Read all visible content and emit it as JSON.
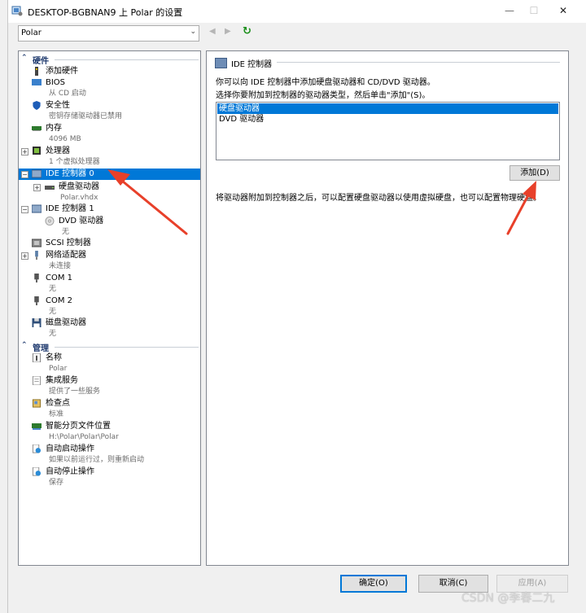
{
  "window": {
    "title": "DESKTOP-BGBNAN9 上 Polar 的设置",
    "minimize": "—",
    "maximize": "☐",
    "close": "✕"
  },
  "toolbar": {
    "vm_select": "Polar",
    "back": "◀",
    "forward": "▶",
    "refresh": "↻"
  },
  "tree": {
    "hardware_header": "硬件",
    "management_header": "管理",
    "items": [
      {
        "label": "添加硬件",
        "sub": ""
      },
      {
        "label": "BIOS",
        "sub": "从 CD 启动"
      },
      {
        "label": "安全性",
        "sub": "密钥存储驱动器已禁用"
      },
      {
        "label": "内存",
        "sub": "4096 MB"
      },
      {
        "label": "处理器",
        "sub": "1 个虚拟处理器"
      },
      {
        "label": "IDE 控制器 0",
        "sub": ""
      },
      {
        "label": "硬盘驱动器",
        "sub": "Polar.vhdx"
      },
      {
        "label": "IDE 控制器 1",
        "sub": ""
      },
      {
        "label": "DVD 驱动器",
        "sub": "无"
      },
      {
        "label": "SCSI 控制器",
        "sub": ""
      },
      {
        "label": "网络适配器",
        "sub": "未连接"
      },
      {
        "label": "COM 1",
        "sub": "无"
      },
      {
        "label": "COM 2",
        "sub": "无"
      },
      {
        "label": "磁盘驱动器",
        "sub": "无"
      },
      {
        "label": "名称",
        "sub": "Polar"
      },
      {
        "label": "集成服务",
        "sub": "提供了一些服务"
      },
      {
        "label": "检查点",
        "sub": "标准"
      },
      {
        "label": "智能分页文件位置",
        "sub": "H:\\Polar\\Polar\\Polar"
      },
      {
        "label": "自动启动操作",
        "sub": "如果以前运行过，则重新启动"
      },
      {
        "label": "自动停止操作",
        "sub": "保存"
      }
    ]
  },
  "panel": {
    "header": "IDE 控制器",
    "desc1": "你可以向 IDE 控制器中添加硬盘驱动器和 CD/DVD 驱动器。",
    "desc2": "选择你要附加到控制器的驱动器类型，然后单击\"添加\"(S)。",
    "options": [
      "硬盘驱动器",
      "DVD 驱动器"
    ],
    "selected_option": "硬盘驱动器",
    "add_button": "添加(D)",
    "note": "将驱动器附加到控制器之后，可以配置硬盘驱动器以使用虚拟硬盘，也可以配置物理硬盘。"
  },
  "footer": {
    "ok": "确定(O)",
    "cancel": "取消(C)",
    "apply": "应用(A)"
  },
  "watermark": "CSDN @季春二九",
  "colors": {
    "selection": "#0078d7",
    "section_header": "#1f3a6e",
    "annotation_arrow": "#e8402a"
  }
}
